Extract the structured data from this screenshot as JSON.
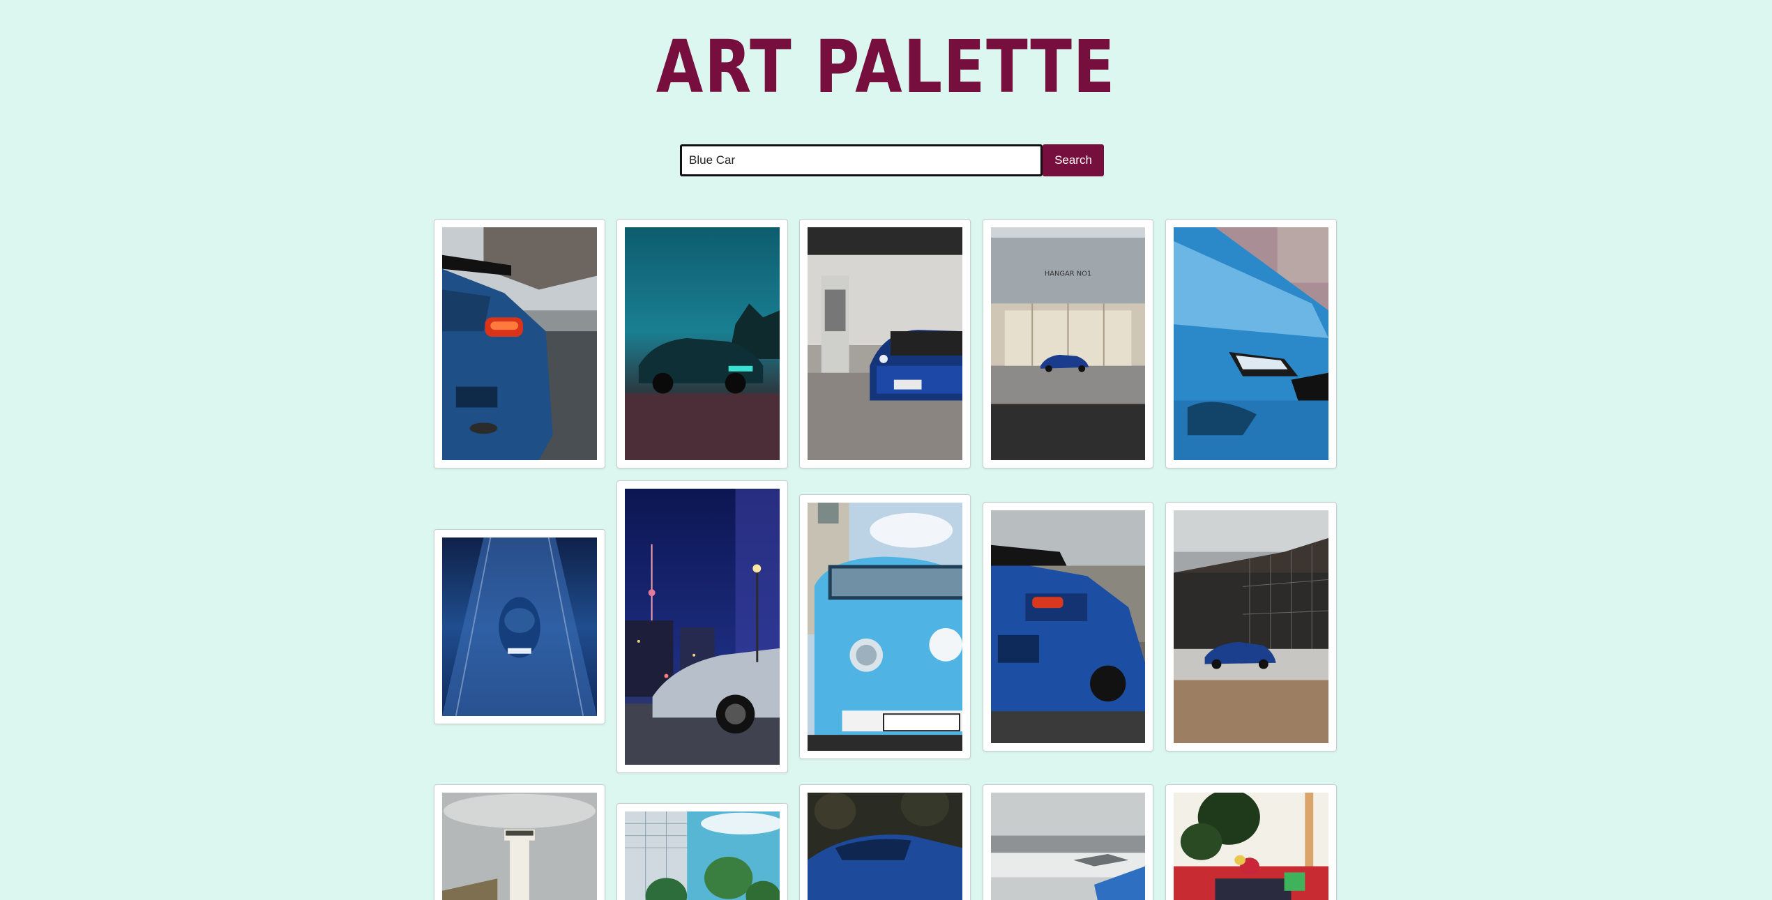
{
  "app": {
    "title": "ART PALETTE"
  },
  "search": {
    "value": "Blue Car",
    "placeholder": "",
    "button_label": "Search"
  },
  "gallery": {
    "query": "Blue Car",
    "images": [
      {
        "name": "rear-spoiler-blue-wrx",
        "hangar_text": ""
      },
      {
        "name": "dark-teal-sports-car",
        "hangar_text": ""
      },
      {
        "name": "blue-car-gas-station",
        "hangar_text": ""
      },
      {
        "name": "blue-car-hangar",
        "hangar_text": "HANGAR NO1"
      },
      {
        "name": "blue-bmw-hood-closeup",
        "hangar_text": ""
      },
      {
        "name": "blue-car-on-road-aerial",
        "hangar_text": ""
      },
      {
        "name": "silver-bmw-city-night",
        "hangar_text": ""
      },
      {
        "name": "light-blue-vw-bus",
        "hangar_text": ""
      },
      {
        "name": "blue-wrx-rear-cloudy",
        "hangar_text": ""
      },
      {
        "name": "blue-car-building",
        "hangar_text": ""
      },
      {
        "name": "control-tower",
        "hangar_text": ""
      },
      {
        "name": "palm-trees-building",
        "hangar_text": ""
      },
      {
        "name": "blue-car-dark-forest",
        "hangar_text": ""
      },
      {
        "name": "airfield-blue-car",
        "hangar_text": ""
      },
      {
        "name": "mural-tree",
        "hangar_text": ""
      }
    ]
  },
  "colors": {
    "background": "#dbf7ef",
    "brand": "#760f3d",
    "card_border": "#c9cfcd"
  }
}
